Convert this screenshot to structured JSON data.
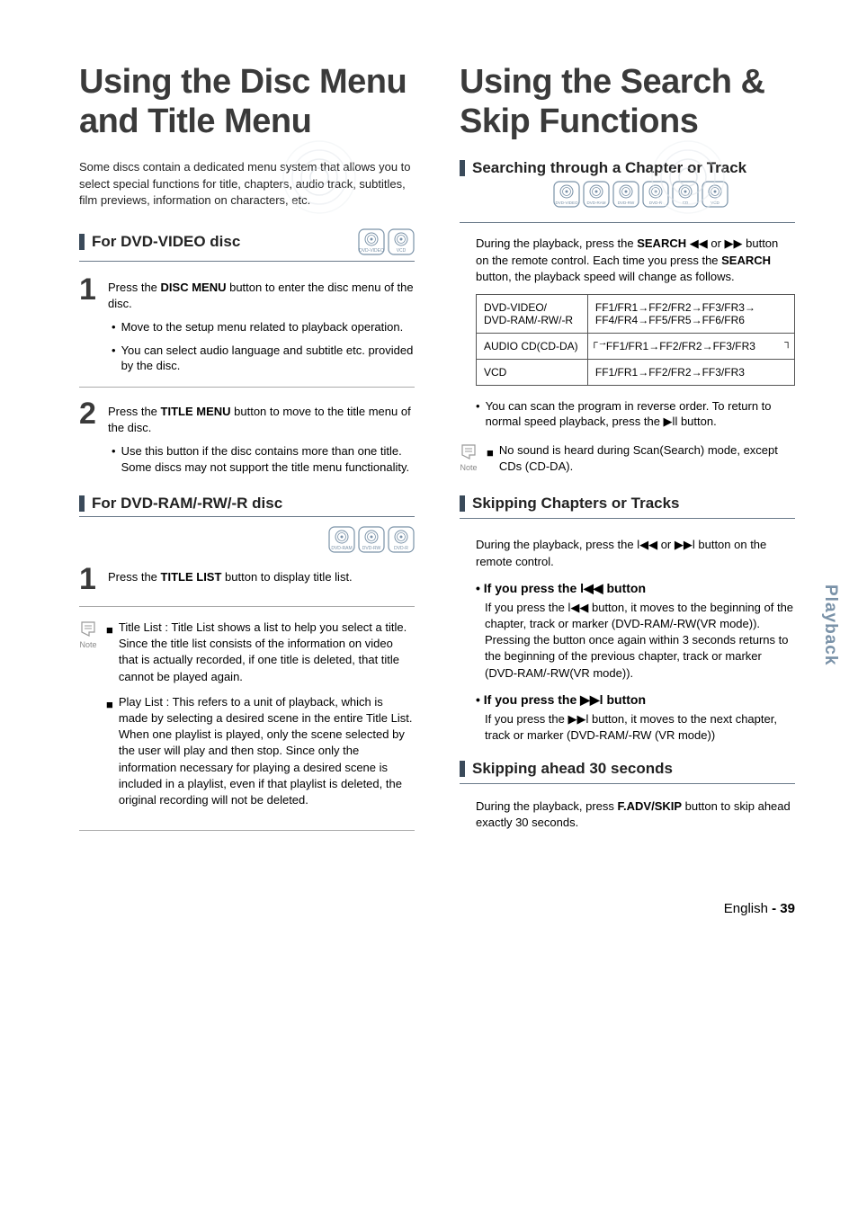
{
  "left": {
    "title": "Using the Disc Menu and Title Menu",
    "intro": "Some discs contain a dedicated menu system that allows you to select special functions for title, chapters, audio track, subtitles, film previews, information on characters, etc.",
    "sectionA": {
      "title": "For DVD-VIDEO disc",
      "icons": [
        "DVD-VIDEO",
        "VCD"
      ],
      "step1_pre": "Press the ",
      "step1_bold": "DISC MENU",
      "step1_post": " button to enter the disc menu of the disc.",
      "bullet1": "Move to the setup menu related to playback operation.",
      "bullet2": "You can select audio language and subtitle etc. provided by the disc.",
      "step2_pre": "Press the ",
      "step2_bold": "TITLE MENU",
      "step2_post": " button to move to the title menu of the disc.",
      "bullet3": "Use this button if the disc contains more than one title. Some discs may not support the title menu functionality."
    },
    "sectionB": {
      "title": "For DVD-RAM/-RW/-R disc",
      "icons": [
        "DVD-RAM",
        "DVD-RW",
        "DVD-R"
      ],
      "step1_pre": "Press the ",
      "step1_bold": "TITLE LIST",
      "step1_post": " button to display title list."
    },
    "notes": {
      "label": "Note",
      "item1_label": "Title List :",
      "item1_body": "Title List shows a list to help you select a title. Since the title list consists of the information on video that is actually recorded, if one title is deleted, that title cannot be played again.",
      "item2_label": "Play List :",
      "item2_body": "This refers to a unit of playback, which is made by selecting a desired scene in the entire Title List. When one playlist is played, only the scene selected by the user will play and then stop. Since only the information necessary for playing a desired scene is included in a playlist, even if that playlist is deleted, the original recording will not be deleted."
    }
  },
  "right": {
    "title": "Using the Search & Skip Functions",
    "sectionA": {
      "title": "Searching through a Chapter or Track",
      "icons": [
        "DVD-VIDEO",
        "DVD-RAM",
        "DVD-RW",
        "DVD-R",
        "CD",
        "VCD"
      ],
      "para_pre": "During the playback, press the ",
      "para_bold1": "SEARCH",
      "para_mid": " ◀◀ or ▶▶ button on the remote control. Each time you press the ",
      "para_bold2": "SEARCH",
      "para_post": " button, the playback speed will change as follows.",
      "table": {
        "r1c1a": "DVD-VIDEO/",
        "r1c1b": "DVD-RAM/-RW/-R",
        "r1c2a": "FF1/FR1→FF2/FR2→FF3/FR3→",
        "r1c2b": "FF4/FR4→FF5/FR5→FF6/FR6",
        "r2c1": "AUDIO CD(CD-DA)",
        "r2c2": "FF1/FR1→FF2/FR2→FF3/FR3",
        "r3c1": "VCD",
        "r3c2": "FF1/FR1→FF2/FR2→FF3/FR3"
      },
      "bullet": "You can scan the program in reverse order. To return to normal speed playback, press the ▶ll button.",
      "note_label": "Note",
      "note_body": "No sound is heard during Scan(Search) mode, except CDs (CD-DA)."
    },
    "sectionB": {
      "title": "Skipping Chapters or Tracks",
      "para": "During the playback, press the l◀◀ or ▶▶l button on the remote control.",
      "sub1_title": "• If you press the l◀◀ button",
      "sub1_body": "If you press the l◀◀ button, it moves to the beginning of the chapter, track or marker (DVD-RAM/-RW(VR mode)). Pressing the button once again within 3 seconds returns to the beginning of  the previous chapter, track or marker (DVD-RAM/-RW(VR mode)).",
      "sub2_title": "• If you press the ▶▶l button",
      "sub2_body": "If you press the ▶▶l button, it moves to the next chapter, track or marker (DVD-RAM/-RW (VR mode))"
    },
    "sectionC": {
      "title": "Skipping ahead 30 seconds",
      "para_pre": "During the playback, press ",
      "para_bold": "F.ADV/SKIP",
      "para_post": " button to skip ahead exactly 30 seconds."
    }
  },
  "sideTab": "Playback",
  "footer_lang": "English",
  "footer_page": "- 39"
}
